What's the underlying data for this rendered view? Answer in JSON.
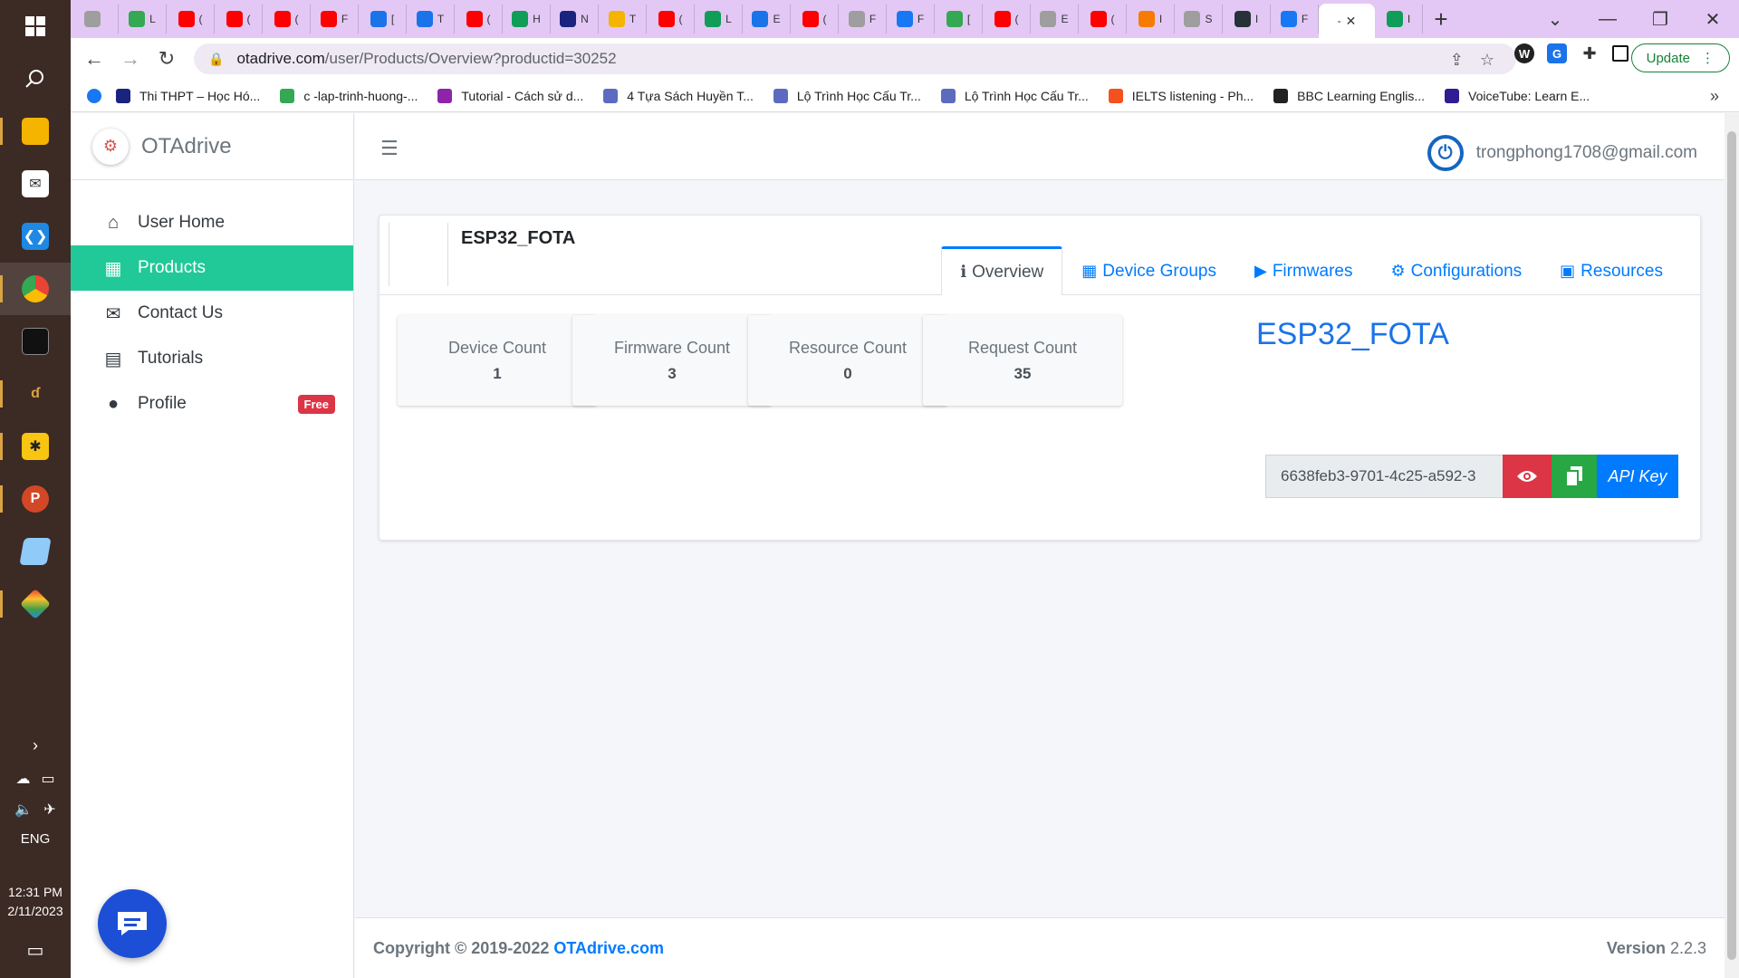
{
  "taskbar": {
    "apps": [
      "windows-start",
      "search",
      "file-explorer",
      "mail",
      "vscode",
      "chrome",
      "terminal",
      "arduino",
      "sourcetree",
      "powerpoint",
      "notes",
      "git"
    ],
    "language": "ENG",
    "time": "12:31 PM",
    "date": "2/11/2023"
  },
  "browser": {
    "tabs": [
      {
        "letter": "",
        "color": "#9e9e9e"
      },
      {
        "letter": "L",
        "color": "#34a853"
      },
      {
        "letter": "(",
        "color": "#ff0000"
      },
      {
        "letter": "(",
        "color": "#ff0000"
      },
      {
        "letter": "(",
        "color": "#ff0000"
      },
      {
        "letter": "F",
        "color": "#ff0000"
      },
      {
        "letter": "[",
        "color": "#1a73e8"
      },
      {
        "letter": "T",
        "color": "#1a73e8"
      },
      {
        "letter": "(",
        "color": "#ff0000"
      },
      {
        "letter": "H",
        "color": "#0f9d58"
      },
      {
        "letter": "N",
        "color": "#1a237e"
      },
      {
        "letter": "T",
        "color": "#f4b400"
      },
      {
        "letter": "(",
        "color": "#ff0000"
      },
      {
        "letter": "L",
        "color": "#0f9d58"
      },
      {
        "letter": "E",
        "color": "#1a73e8"
      },
      {
        "letter": "(",
        "color": "#ff0000"
      },
      {
        "letter": "F",
        "color": "#9e9e9e"
      },
      {
        "letter": "F",
        "color": "#1877f2"
      },
      {
        "letter": "[",
        "color": "#34a853"
      },
      {
        "letter": "(",
        "color": "#ff0000"
      },
      {
        "letter": "E",
        "color": "#9e9e9e"
      },
      {
        "letter": "(",
        "color": "#ff0000"
      },
      {
        "letter": "I",
        "color": "#f57c00"
      },
      {
        "letter": "S",
        "color": "#9e9e9e"
      },
      {
        "letter": "I",
        "color": "#263238"
      },
      {
        "letter": "F",
        "color": "#1877f2"
      }
    ],
    "current_tab_label": "-",
    "last_tab_letter": "I",
    "url_host": "otadrive.com",
    "url_path": "/user/Products/Overview?productid=30252",
    "update_label": "Update",
    "bookmarks": [
      {
        "label": "Thi THPT – Học Hó...",
        "color": "#1a237e"
      },
      {
        "label": "c -lap-trinh-huong-...",
        "color": "#34a853"
      },
      {
        "label": "Tutorial - Cách sử d...",
        "color": "#8e24aa"
      },
      {
        "label": "4 Tựa Sách Huyền T...",
        "color": "#5c6bc0"
      },
      {
        "label": "Lộ Trình Học Cấu Tr...",
        "color": "#5c6bc0"
      },
      {
        "label": "Lộ Trình Học Cấu Tr...",
        "color": "#5c6bc0"
      },
      {
        "label": "IELTS listening - Ph...",
        "color": "#f4511e"
      },
      {
        "label": "BBC Learning Englis...",
        "color": "#222222"
      },
      {
        "label": "VoiceTube: Learn E...",
        "color": "#311b92"
      }
    ]
  },
  "app": {
    "brand": "OTAdrive",
    "menu": [
      {
        "label": "User Home",
        "icon": "home-icon"
      },
      {
        "label": "Products",
        "icon": "grid-icon"
      },
      {
        "label": "Contact Us",
        "icon": "envelope-icon"
      },
      {
        "label": "Tutorials",
        "icon": "book-icon"
      },
      {
        "label": "Profile",
        "icon": "user-icon"
      }
    ],
    "profile_badge": "Free",
    "user_email": "trongphong1708@gmail.com"
  },
  "product": {
    "name": "ESP32_FOTA",
    "title": "ESP32_FOTA",
    "tabs": [
      "Overview",
      "Device Groups",
      "Firmwares",
      "Configurations",
      "Resources"
    ],
    "active_tab": "Overview",
    "stats": [
      {
        "label": "Device Count",
        "value": "1"
      },
      {
        "label": "Firmware Count",
        "value": "3"
      },
      {
        "label": "Resource Count",
        "value": "0"
      },
      {
        "label": "Request Count",
        "value": "35"
      }
    ],
    "api_key_value": "6638feb3-9701-4c25-a592-3",
    "api_key_label": "API Key"
  },
  "footer": {
    "copyright_prefix": "Copyright © 2019-2022",
    "copyright_link": "OTAdrive.com",
    "version_label": "Version",
    "version_number": "2.2.3"
  },
  "colors": {
    "sidebar_active": "#20c997",
    "link": "#007bff",
    "tab_strip": "#e3c8f5",
    "badge": "#dc3545"
  }
}
